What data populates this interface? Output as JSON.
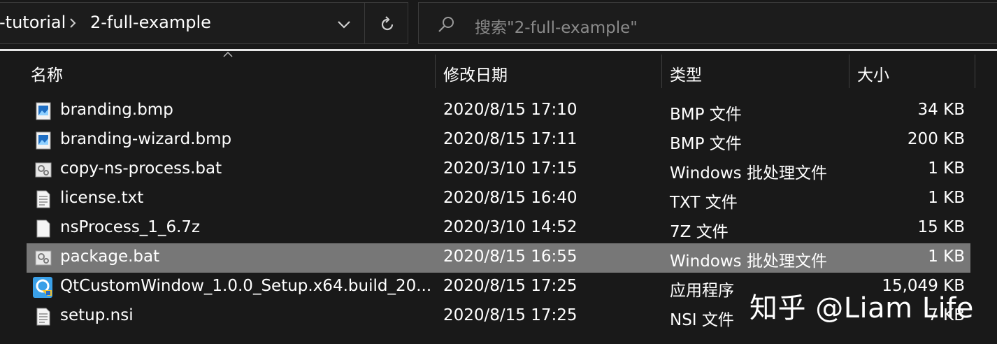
{
  "address": {
    "crumb_partial": "-tutorial",
    "crumb_current": "2-full-example"
  },
  "search": {
    "placeholder": "搜索\"2-full-example\""
  },
  "columns": {
    "name": "名称",
    "date": "修改日期",
    "type": "类型",
    "size": "大小"
  },
  "files": [
    {
      "name": "branding.bmp",
      "date": "2020/8/15 17:10",
      "type": "BMP 文件",
      "size": "34 KB",
      "icon": "image-file-icon"
    },
    {
      "name": "branding-wizard.bmp",
      "date": "2020/8/15 17:11",
      "type": "BMP 文件",
      "size": "200 KB",
      "icon": "image-file-icon"
    },
    {
      "name": "copy-ns-process.bat",
      "date": "2020/3/10 17:15",
      "type": "Windows 批处理文件",
      "size": "1 KB",
      "icon": "batch-file-icon"
    },
    {
      "name": "license.txt",
      "date": "2020/8/15 16:40",
      "type": "TXT 文件",
      "size": "1 KB",
      "icon": "text-file-icon"
    },
    {
      "name": "nsProcess_1_6.7z",
      "date": "2020/3/10 14:52",
      "type": "7Z 文件",
      "size": "15 KB",
      "icon": "blank-file-icon"
    },
    {
      "name": "package.bat",
      "date": "2020/8/15 16:55",
      "type": "Windows 批处理文件",
      "size": "1 KB",
      "icon": "batch-file-icon",
      "selected": true
    },
    {
      "name": "QtCustomWindow_1.0.0_Setup.x64.build_20...",
      "date": "2020/8/15 17:25",
      "type": "应用程序",
      "size": "15,049 KB",
      "icon": "installer-shield-icon"
    },
    {
      "name": "setup.nsi",
      "date": "2020/8/15 17:25",
      "type": "NSI 文件",
      "size": "7 KB",
      "icon": "text-file-icon"
    }
  ],
  "watermark": "知乎 @Liam Life"
}
